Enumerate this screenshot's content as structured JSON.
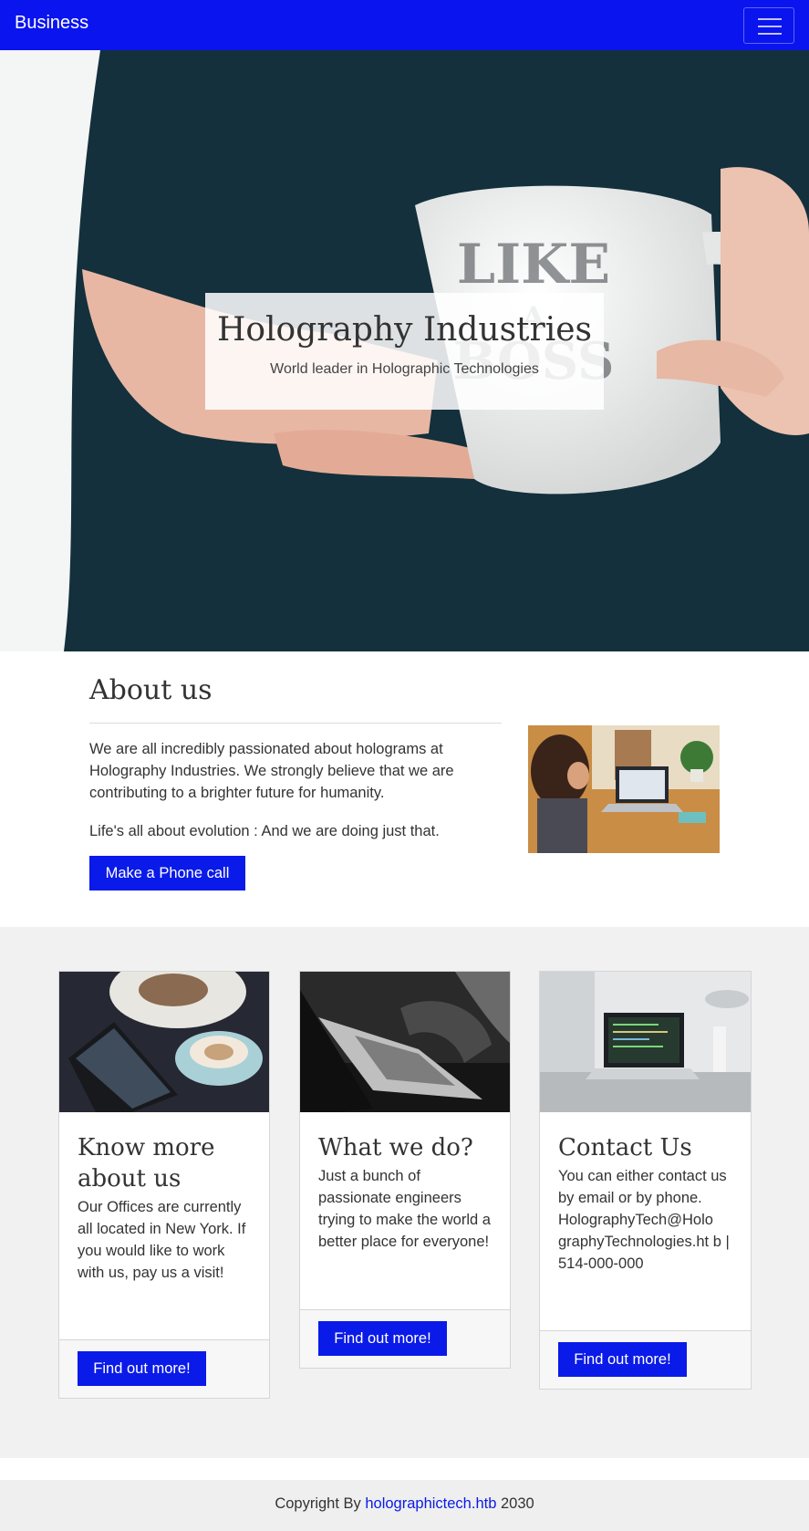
{
  "navbar": {
    "brand": "Business",
    "menu_icon": "hamburger-menu-icon"
  },
  "hero": {
    "title": "Holography Industries",
    "subtitle": "World leader in Holographic Technologies",
    "mug_text": [
      "LIKE",
      "A",
      "BOSS"
    ]
  },
  "about": {
    "title": "About us",
    "paragraph1": "We are all incredibly passionated about holograms at Holography Industries. We strongly believe that we are contributing to a brighter future for humanity.",
    "paragraph2": "Life's all about evolution : And we are doing just that.",
    "button": "Make a Phone call"
  },
  "cards": [
    {
      "title": "Know more about us",
      "text": "Our Offices are currently all located in New York. If you would like to work with us, pay us a visit!",
      "button": "Find out more!"
    },
    {
      "title": "What we do?",
      "text": "Just a bunch of passionate engineers trying to make the world a better place for everyone!",
      "button": "Find out more!"
    },
    {
      "title": "Contact Us",
      "text": "You can either contact us by email or by phone. HolographyTech@Holo graphyTechnologies.ht b | 514-000-000",
      "button": "Find out more!"
    }
  ],
  "footer": {
    "prefix": "Copyright By ",
    "link": "holographictech.htb",
    "suffix": " 2030"
  },
  "colors": {
    "primary": "#0a14ee",
    "button": "#0a1ae8",
    "section_bg": "#f1f1f1"
  }
}
